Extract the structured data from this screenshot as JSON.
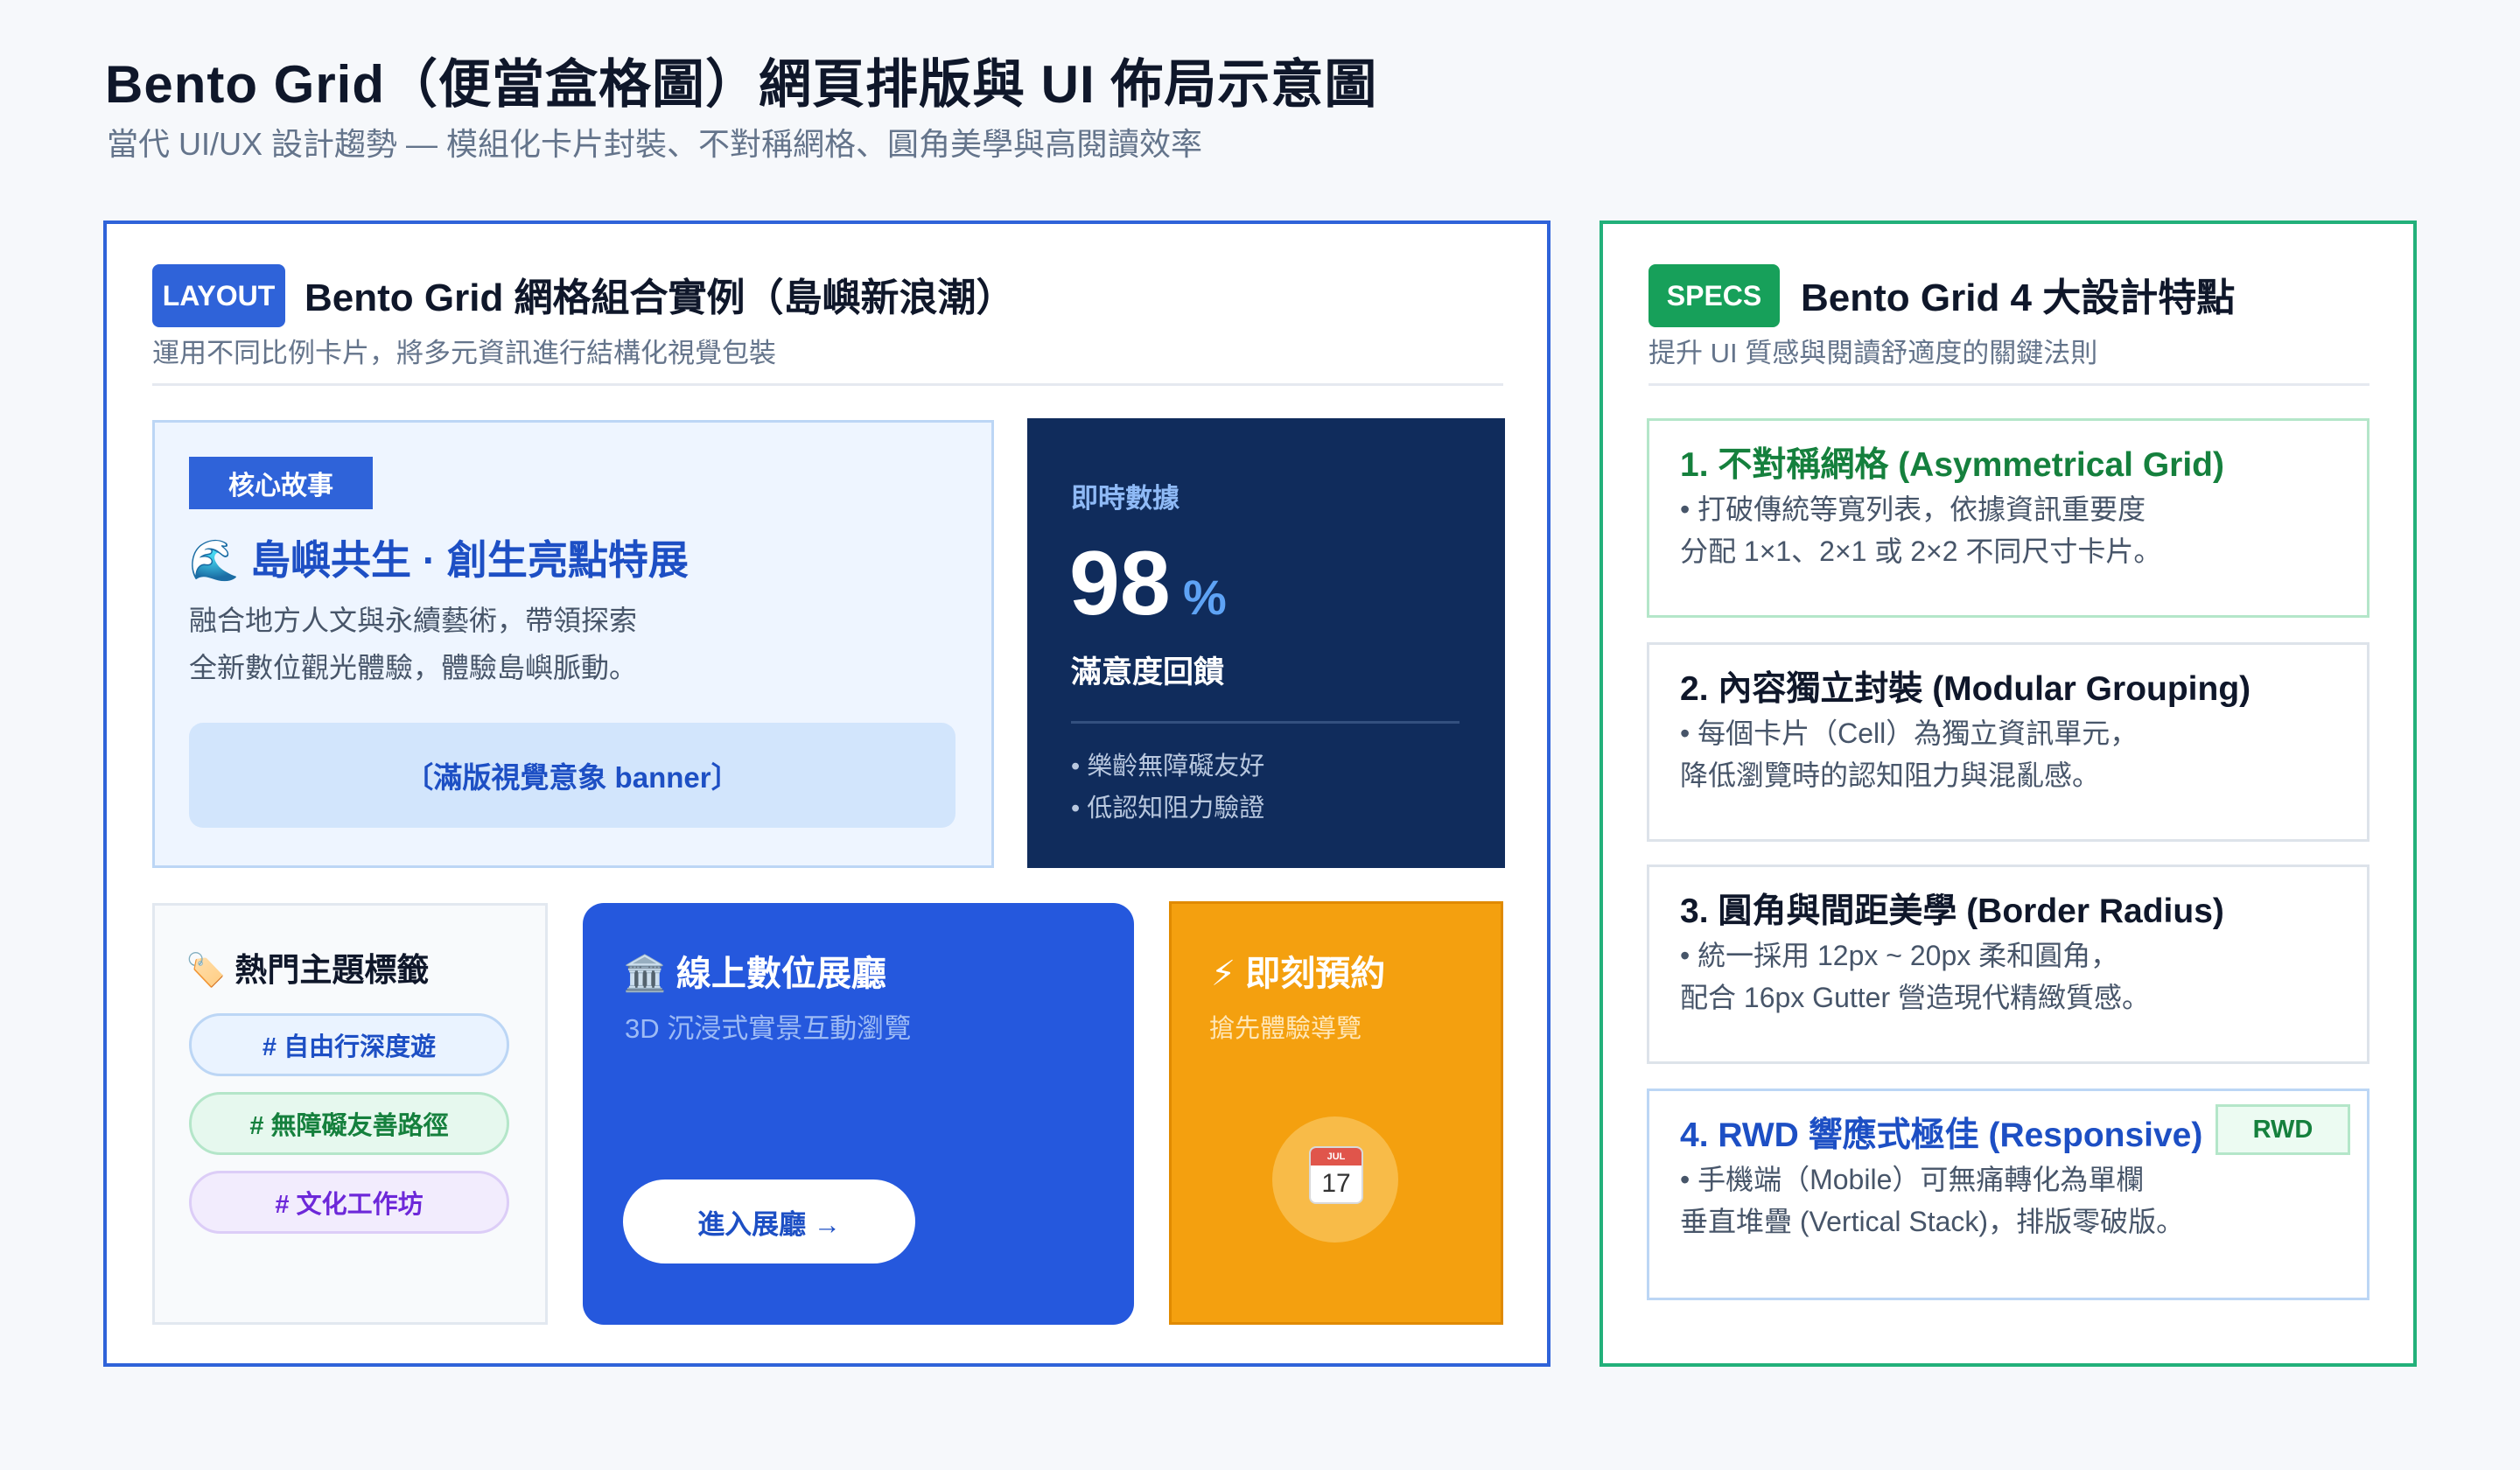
{
  "header": {
    "title": "Bento Grid（便當盒格圖）網頁排版與 UI 佈局示意圖",
    "subtitle": "當代 UI/UX 設計趨勢 — 模組化卡片封裝、不對稱網格、圓角美學與高閱讀效率"
  },
  "layout_panel": {
    "tag": "LAYOUT",
    "title": "Bento Grid 網格組合實例（島嶼新浪潮）",
    "subtitle": "運用不同比例卡片，將多元資訊進行結構化視覺包裝",
    "hero": {
      "tag": "核心故事",
      "title": "🌊 島嶼共生 · 創生亮點特展",
      "desc_line1": "融合地方人文與永續藝術，帶領探索",
      "desc_line2": "全新數位觀光體驗，體驗島嶼脈動。",
      "banner": "〔滿版視覺意象 banner〕"
    },
    "stats": {
      "label": "即時數據",
      "value": "98",
      "unit": "%",
      "caption": "滿意度回饋",
      "items": [
        "• 樂齡無障礙友好",
        "• 低認知阻力驗證"
      ]
    },
    "topics": {
      "title": "🏷️ 熱門主題標籤",
      "tags": [
        "# 自由行深度遊",
        "# 無障礙友善路徑",
        "# 文化工作坊"
      ]
    },
    "hall": {
      "title": "🏛️ 線上數位展廳",
      "subtitle": "3D 沉浸式實景互動瀏覽",
      "button": "進入展廳 →"
    },
    "booking": {
      "title": "⚡ 即刻預約",
      "subtitle": "搶先體驗導覽",
      "calendar_month": "JUL",
      "calendar_day": "17"
    }
  },
  "specs_panel": {
    "tag": "SPECS",
    "title": "Bento Grid 4 大設計特點",
    "subtitle": "提升 UI 質感與閱讀舒適度的關鍵法則",
    "items": [
      {
        "title": "1. 不對稱網格 (Asymmetrical Grid)",
        "line1": "• 打破傳統等寬列表，依據資訊重要度",
        "line2": "分配 1×1、2×1 或 2×2 不同尺寸卡片。"
      },
      {
        "title": "2. 內容獨立封裝 (Modular Grouping)",
        "line1": "• 每個卡片（Cell）為獨立資訊單元，",
        "line2": "降低瀏覽時的認知阻力與混亂感。"
      },
      {
        "title": "3. 圓角與間距美學 (Border Radius)",
        "line1": "• 統一採用 12px ~ 20px 柔和圓角，",
        "line2": "配合 16px Gutter 營造現代精緻質感。"
      },
      {
        "title": "4. RWD 響應式極佳 (Responsive)",
        "badge": "RWD",
        "line1": "• 手機端（Mobile）可無痛轉化為單欄",
        "line2": "垂直堆疊 (Vertical Stack)，排版零破版。"
      }
    ]
  },
  "colors": {
    "layout_accent": "#2f63d9",
    "specs_accent": "#22b07a",
    "stats_bg": "#102c5c",
    "hall_bg": "#2558dd",
    "booking_bg": "#f4a00f"
  }
}
